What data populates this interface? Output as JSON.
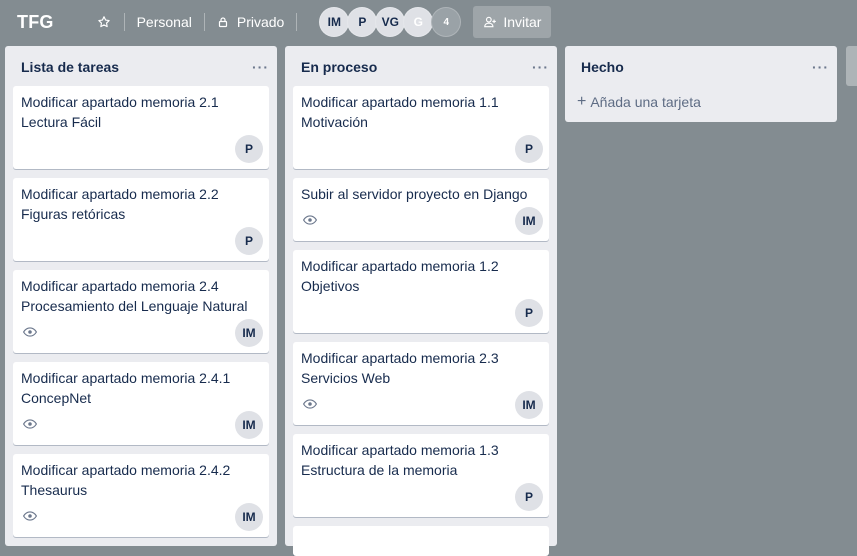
{
  "header": {
    "title": "TFG",
    "team": "Personal",
    "visibility": "Privado",
    "members": [
      "IM",
      "P",
      "VG",
      "G"
    ],
    "member_count": "4",
    "invite": "Invitar"
  },
  "lists": [
    {
      "title": "Lista de tareas",
      "menu": "···",
      "cards": [
        {
          "line1": "Modificar apartado memoria 2.1",
          "line2": "Lectura Fácil",
          "member": "P"
        },
        {
          "line1": "Modificar apartado memoria 2.2",
          "line2": "Figuras retóricas",
          "member": "P"
        },
        {
          "line1": "Modificar apartado memoria 2.4",
          "line2": "Procesamiento del Lenguaje Natural",
          "member": "IM"
        },
        {
          "line1": "Modificar apartado memoria 2.4.1",
          "line2": "ConcepNet",
          "member": "IM"
        },
        {
          "line1": "Modificar apartado memoria 2.4.2",
          "line2": "Thesaurus",
          "member": "IM"
        }
      ]
    },
    {
      "title": "En proceso",
      "menu": "···",
      "cards": [
        {
          "line1": "Modificar apartado memoria 1.1",
          "line2": "Motivación",
          "member": "P"
        },
        {
          "line1": "Subir al servidor proyecto en Django",
          "member": "IM"
        },
        {
          "line1": "Modificar apartado memoria 1.2",
          "line2": "Objetivos",
          "member": "P"
        },
        {
          "line1": "Modificar apartado memoria 2.3",
          "line2": "Servicios Web",
          "member": "IM"
        },
        {
          "line1": "Modificar apartado memoria 1.3",
          "line2": "Estructura de la memoria",
          "member": "P"
        }
      ]
    },
    {
      "title": "Hecho",
      "menu": "···",
      "add_card": "Añada una tarjeta"
    }
  ],
  "colors": {
    "board_background": "#838c91",
    "list_background": "#ebecf0",
    "card_background": "#ffffff",
    "text": "#172b4d"
  },
  "icons": [
    "star-icon",
    "lock-icon",
    "add-member-icon",
    "eye-icon",
    "plus-icon",
    "more-icon"
  ]
}
